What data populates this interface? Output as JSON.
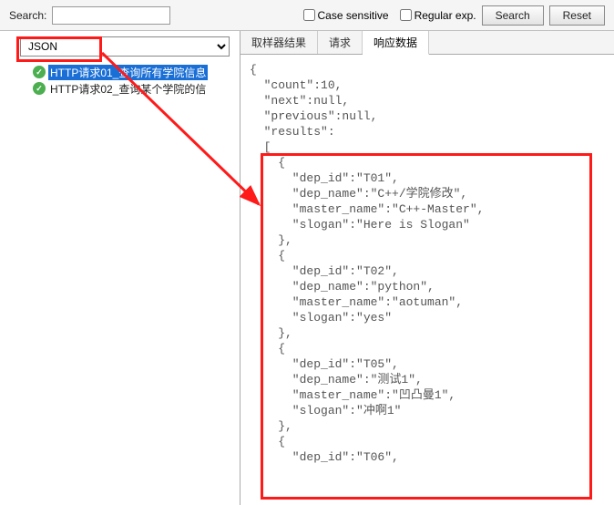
{
  "search": {
    "label": "Search:",
    "value": "",
    "case_sensitive_label": "Case sensitive",
    "regex_label": "Regular exp.",
    "search_btn": "Search",
    "reset_btn": "Reset"
  },
  "left": {
    "format_selected": "JSON",
    "tree": [
      {
        "label": "HTTP请求01_查询所有学院信息",
        "selected": true
      },
      {
        "label": "HTTP请求02_查询某个学院的信",
        "selected": false
      }
    ]
  },
  "tabs": {
    "t1": "取样器结果",
    "t2": "请求",
    "t3": "响应数据"
  },
  "code_lines": [
    "{",
    "  \"count\":10,",
    "  \"next\":null,",
    "  \"previous\":null,",
    "  \"results\":",
    "  [",
    "    {",
    "      \"dep_id\":\"T01\",",
    "      \"dep_name\":\"C++/学院修改\",",
    "      \"master_name\":\"C++-Master\",",
    "      \"slogan\":\"Here is Slogan\"",
    "    },",
    "    {",
    "      \"dep_id\":\"T02\",",
    "      \"dep_name\":\"python\",",
    "      \"master_name\":\"aotuman\",",
    "      \"slogan\":\"yes\"",
    "    },",
    "    {",
    "      \"dep_id\":\"T05\",",
    "      \"dep_name\":\"测试1\",",
    "      \"master_name\":\"凹凸曼1\",",
    "      \"slogan\":\"冲啊1\"",
    "    },",
    "    {",
    "      \"dep_id\":\"T06\","
  ]
}
